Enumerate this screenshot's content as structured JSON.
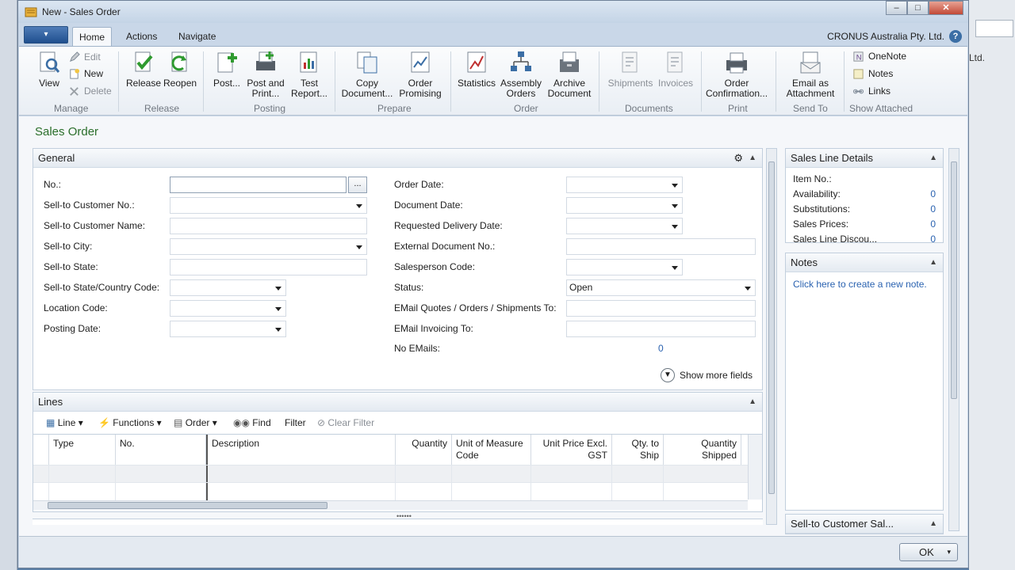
{
  "window": {
    "title": "New - Sales Order",
    "minimize": "‒",
    "maximize": "□",
    "close": "✕"
  },
  "tabs": [
    "Home",
    "Actions",
    "Navigate"
  ],
  "company": "CRONUS Australia Pty. Ltd.",
  "help_glyph": "?",
  "background": {
    "right_text": "Ltd."
  },
  "ribbon": {
    "manage": {
      "view": "View",
      "edit": "Edit",
      "new": "New",
      "delete": "Delete",
      "group": "Manage"
    },
    "release": {
      "release": "Release",
      "reopen": "Reopen",
      "group": "Release"
    },
    "posting": {
      "post": "Post...",
      "post_print_1": "Post and",
      "post_print_2": "Print...",
      "test_1": "Test",
      "test_2": "Report...",
      "group": "Posting"
    },
    "prepare": {
      "copy_1": "Copy",
      "copy_2": "Document...",
      "promising_1": "Order",
      "promising_2": "Promising",
      "group": "Prepare"
    },
    "order": {
      "statistics": "Statistics",
      "assembly_1": "Assembly",
      "assembly_2": "Orders",
      "archive_1": "Archive",
      "archive_2": "Document",
      "group": "Order"
    },
    "documents": {
      "shipments": "Shipments",
      "invoices": "Invoices",
      "group": "Documents"
    },
    "print": {
      "oc_1": "Order",
      "oc_2": "Confirmation...",
      "group": "Print"
    },
    "sendto": {
      "em_1": "Email as",
      "em_2": "Attachment",
      "group": "Send To"
    },
    "attached": {
      "onenote": "OneNote",
      "notes": "Notes",
      "links": "Links",
      "group": "Show Attached"
    }
  },
  "page_title": "Sales Order",
  "general": {
    "header": "General",
    "left": [
      {
        "label": "No.:",
        "value": ""
      },
      {
        "label": "Sell-to Customer No.:",
        "value": ""
      },
      {
        "label": "Sell-to Customer Name:",
        "value": ""
      },
      {
        "label": "Sell-to City:",
        "value": ""
      },
      {
        "label": "Sell-to State:",
        "value": ""
      },
      {
        "label": "Sell-to State/Country Code:",
        "value": ""
      },
      {
        "label": "Location Code:",
        "value": ""
      },
      {
        "label": "Posting Date:",
        "value": ""
      }
    ],
    "right": [
      {
        "label": "Order Date:",
        "value": ""
      },
      {
        "label": "Document Date:",
        "value": ""
      },
      {
        "label": "Requested Delivery Date:",
        "value": ""
      },
      {
        "label": "External Document No.:",
        "value": ""
      },
      {
        "label": "Salesperson Code:",
        "value": ""
      },
      {
        "label": "Status:",
        "value": "Open"
      },
      {
        "label": "EMail Quotes / Orders / Shipments To:",
        "value": ""
      },
      {
        "label": "EMail Invoicing To:",
        "value": ""
      },
      {
        "label": "No EMails:",
        "value": "0"
      }
    ],
    "ellipsis": "...",
    "show_more": "Show more fields"
  },
  "lines": {
    "header": "Lines",
    "toolbar": {
      "line": "Line",
      "functions": "Functions",
      "order": "Order",
      "find": "Find",
      "filter": "Filter",
      "clear_filter": "Clear Filter"
    },
    "columns": [
      {
        "l1": "Type",
        "l2": ""
      },
      {
        "l1": "No.",
        "l2": ""
      },
      {
        "l1": "Description",
        "l2": ""
      },
      {
        "l1": "Quantity",
        "l2": ""
      },
      {
        "l1": "Unit of Measure",
        "l2": "Code"
      },
      {
        "l1": "Unit Price Excl.",
        "l2": "GST"
      },
      {
        "l1": "Qty. to",
        "l2": "Ship"
      },
      {
        "l1": "Quantity",
        "l2": "Shipped"
      }
    ]
  },
  "factbox": {
    "sales_line": {
      "header": "Sales Line Details",
      "rows": [
        {
          "label": "Item No.:",
          "value": ""
        },
        {
          "label": "Availability:",
          "value": "0"
        },
        {
          "label": "Substitutions:",
          "value": "0"
        },
        {
          "label": "Sales Prices:",
          "value": "0"
        },
        {
          "label": "Sales Line Discou...",
          "value": "0"
        }
      ]
    },
    "notes": {
      "header": "Notes",
      "link": "Click here to create a new note."
    },
    "customer": {
      "header": "Sell-to Customer Sal..."
    }
  },
  "ok": "OK",
  "colors": {
    "accent": "#2a62b0",
    "title_green": "#2a6e2a"
  }
}
